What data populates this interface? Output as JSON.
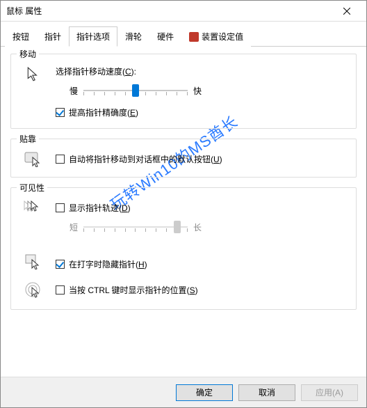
{
  "window": {
    "title": "鼠标 属性"
  },
  "tabs": {
    "items": [
      {
        "label": "按钮"
      },
      {
        "label": "指针"
      },
      {
        "label": "指针选项"
      },
      {
        "label": "滑轮"
      },
      {
        "label": "硬件"
      },
      {
        "label": "装置设定值"
      }
    ],
    "active_index": 2
  },
  "groups": {
    "motion": {
      "title": "移动",
      "speed_label_pre": "选择指针移动速度(",
      "speed_hotkey": "C",
      "speed_label_post": "):",
      "slow": "慢",
      "fast": "快",
      "speed_value": 6,
      "speed_ticks": 11,
      "enhance_label_pre": "提高指针精确度(",
      "enhance_hotkey": "E",
      "enhance_label_post": ")",
      "enhance_checked": true
    },
    "snap": {
      "title": "贴靠",
      "label_pre": "自动将指针移动到对话框中的默认按钮(",
      "hotkey": "U",
      "label_post": ")",
      "checked": false
    },
    "visibility": {
      "title": "可见性",
      "trails_label_pre": "显示指针轨迹(",
      "trails_hotkey": "D",
      "trails_label_post": ")",
      "trails_checked": false,
      "short": "短",
      "long": "长",
      "trails_value": 10,
      "trails_ticks": 11,
      "trails_enabled": false,
      "hide_label_pre": "在打字时隐藏指针(",
      "hide_hotkey": "H",
      "hide_label_post": ")",
      "hide_checked": true,
      "show_label_pre": "当按 CTRL 键时显示指针的位置(",
      "show_hotkey": "S",
      "show_label_post": ")",
      "show_checked": false
    }
  },
  "footer": {
    "ok": "确定",
    "cancel": "取消",
    "apply": "应用(A)"
  },
  "watermark": "玩转Win10的MS酋长"
}
